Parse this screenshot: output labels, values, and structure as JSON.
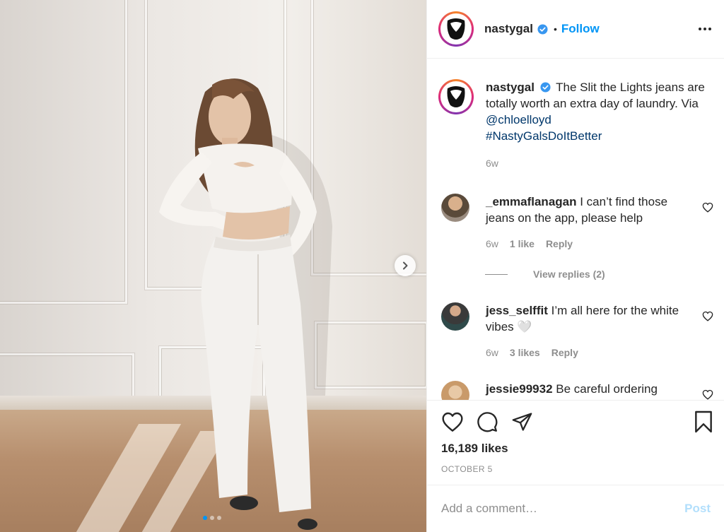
{
  "post": {
    "username": "nastygal",
    "follow_label": "Follow",
    "separator": "•",
    "image_alt": "Woman in white cropped top and white jeans leaning on a paneled wall",
    "carousel": {
      "slide_count": 3,
      "current": 1
    },
    "caption": {
      "username": "nastygal",
      "text": "The Slit the Lights jeans are totally worth an extra day of laundry. Via",
      "mention": "@chloelloyd",
      "hashtag": "#NastyGalsDoItBetter",
      "age": "6w"
    },
    "comments": [
      {
        "username": "_emmaflanagan",
        "text": "I can’t find those jeans on the app, please help",
        "age": "6w",
        "likes": "1 like",
        "reply_label": "Reply"
      },
      {
        "username": "jess_selffit",
        "text": "I’m all here for the white vibes 🤍",
        "age": "6w",
        "likes": "3 likes",
        "reply_label": "Reply"
      },
      {
        "username": "jessie99932",
        "text": "Be careful ordering"
      }
    ],
    "view_replies_label": "View replies (2)",
    "likes_count": "16,189 likes",
    "date": "OCTOBER 5",
    "comment_placeholder": "Add a comment…",
    "post_label": "Post"
  },
  "colors": {
    "accent": "#0095f6",
    "text": "#262626",
    "muted": "#8e8e8e",
    "link": "#00376b",
    "post_disabled": "#b2dffc"
  },
  "icons": [
    "verified-badge-icon",
    "more-options-icon",
    "chevron-right-icon",
    "heart-icon",
    "comment-icon",
    "share-icon",
    "bookmark-icon"
  ]
}
